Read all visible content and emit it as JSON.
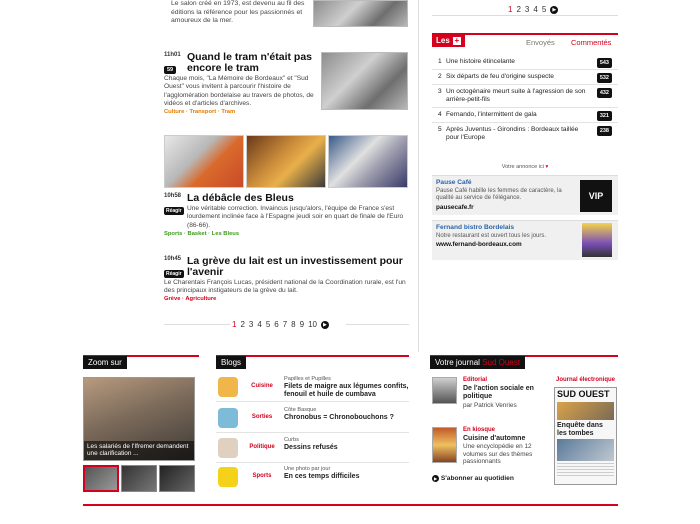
{
  "intro": {
    "text": "Le salon créé en 1973, est devenu au fil des éditions la référence pour les passionnés et amoureux de la mer."
  },
  "articles": [
    {
      "time": "11h01",
      "count": "59",
      "headline": "Quand le tram n'était pas encore le tram",
      "body": "Chaque mois, \"La Mémoire de Bordeaux\" et \"Sud Ouest\" vous invitent à parcourir l'histoire de l'agglomération bordelaise au travers de photos, de vidéos et d'articles d'archives.",
      "tags": "Culture · Transport · Tram"
    },
    {
      "time": "10h58",
      "count": "Réagir",
      "headline": "La débâcle des Bleus",
      "body": "Une véritable correction. Invaincus jusqu'alors, l'équipe de France s'est lourdement inclinée face à l'Espagne jeudi soir en quart de finale de l'Euro (86-66).",
      "tags": "Sports · Basket · Les Bleus"
    },
    {
      "time": "10h45",
      "count": "Réagir",
      "headline": "La grève du lait est un investissement pour l'avenir",
      "body": "Le Charentais François Lucas, président national de la Coordination rurale, est l'un des principaux instigateurs de la grève du lait.",
      "tags": "Grève · Agriculture"
    }
  ],
  "pagination": {
    "pages": [
      "1",
      "2",
      "3",
      "4",
      "5",
      "6",
      "7",
      "8",
      "9",
      "10"
    ],
    "current": "1",
    "top_pages": [
      "1",
      "2",
      "3",
      "4",
      "5"
    ]
  },
  "les_box": {
    "tab_label": "Les",
    "plus": "+",
    "tab_envoyes": "Envoyés",
    "tab_commentes": "Commentés",
    "items": [
      {
        "num": "1",
        "text": "Une histoire étincelante",
        "count": "543"
      },
      {
        "num": "2",
        "text": "Six départs de feu d'origine suspecte",
        "count": "532"
      },
      {
        "num": "3",
        "text": "Un octogénaire meurt suite à l'agression de son arrière-petit-fils",
        "count": "432"
      },
      {
        "num": "4",
        "text": "Fernando, l'intermittent de gala",
        "count": "321"
      },
      {
        "num": "5",
        "text": "Après Juventus - Girondins : Bordeaux taillée pour l'Europe",
        "count": "238"
      }
    ]
  },
  "ads": {
    "label": "Votre annonce ici",
    "items": [
      {
        "title": "Pause Café",
        "text": "Pause Café habille les femmes de caractère, la qualité au service de l'élégance.",
        "link": "pausecafe.fr",
        "logo": "VIP"
      },
      {
        "title": "Fernand bistro Bordelais",
        "text": "Notre restaurant est ouvert tous les jours.",
        "link": "www.fernand-bordeaux.com"
      }
    ]
  },
  "zoom": {
    "label": "Zoom sur",
    "caption": "Les salariés de l'Ifremer demandent une clarification ..."
  },
  "blogs": {
    "label": "Blogs",
    "items": [
      {
        "cat": "Cuisine",
        "sub": "Papilles et Pupilles",
        "title": "Filets de maigre aux légumes confits, fenouil et huile de cumbava"
      },
      {
        "cat": "Sorties",
        "sub": "Côte Basque",
        "title": "Chronobus = Chronobouchons ?"
      },
      {
        "cat": "Politique",
        "sub": "Curbs",
        "title": "Dessins refusés"
      },
      {
        "cat": "Sports",
        "sub": "Une photo par jour",
        "title": "En ces temps difficiles"
      }
    ]
  },
  "journal": {
    "label_prefix": "Votre journal",
    "label_brand": "Sud Ouest",
    "editorial_cat": "Editorial",
    "editorial_title": "De l'action sociale en politique",
    "editorial_author": "par Patrick Venries",
    "kiosque_cat": "En kiosque",
    "kiosque_title": "Cuisine d'automne",
    "kiosque_text": "Une encyclopédie en 12 volumes sur des thèmes passionnants",
    "subscribe": "S'abonner au quotidien",
    "electronic_label": "Journal électronique",
    "paper_masthead": "SUD OUEST",
    "paper_headline": "Enquête dans les tombes"
  },
  "colors": {
    "accent": "#d4001d",
    "dark": "#111111",
    "link_blue": "#2a64a8"
  }
}
